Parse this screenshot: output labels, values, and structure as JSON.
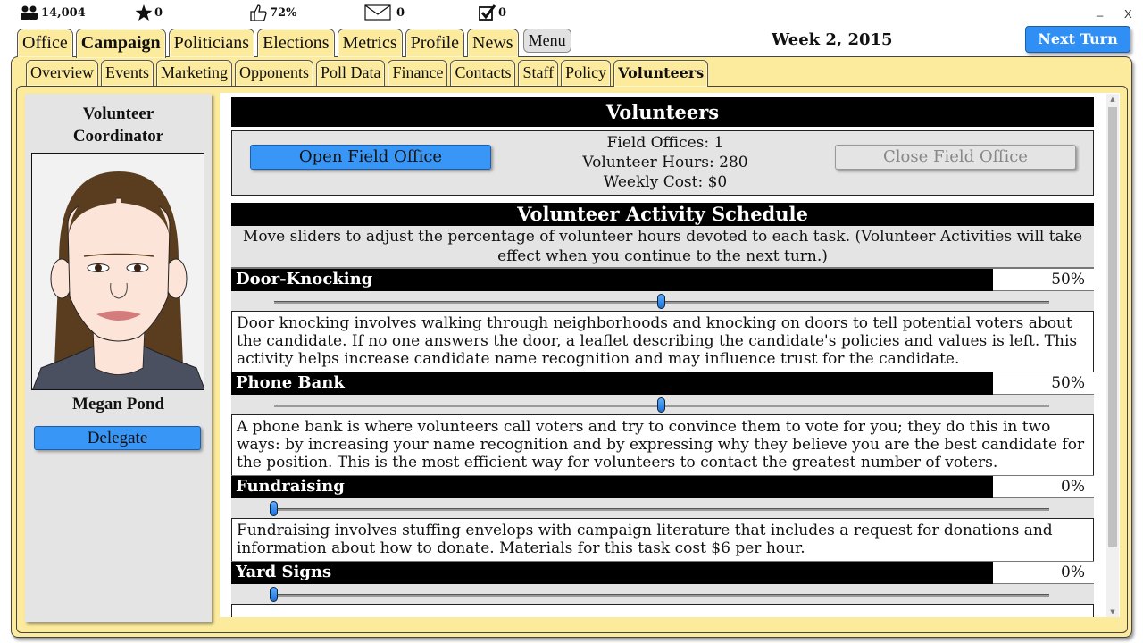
{
  "stats": {
    "followers": "14,004",
    "stars": "0",
    "approval": "72%",
    "messages": "0",
    "tasks": "0"
  },
  "window": {
    "minimize": "_",
    "close": "X"
  },
  "main_tabs": [
    {
      "label": "Office"
    },
    {
      "label": "Campaign",
      "active": true
    },
    {
      "label": "Politicians"
    },
    {
      "label": "Elections"
    },
    {
      "label": "Metrics"
    },
    {
      "label": "Profile"
    },
    {
      "label": "News"
    }
  ],
  "menu_label": "Menu",
  "week": "Week 2, 2015",
  "next_turn_label": "Next Turn",
  "sub_tabs": [
    {
      "label": "Overview"
    },
    {
      "label": "Events"
    },
    {
      "label": "Marketing"
    },
    {
      "label": "Opponents"
    },
    {
      "label": "Poll Data"
    },
    {
      "label": "Finance"
    },
    {
      "label": "Contacts"
    },
    {
      "label": "Staff"
    },
    {
      "label": "Policy"
    },
    {
      "label": "Volunteers",
      "active": true
    }
  ],
  "coordinator": {
    "title_line1": "Volunteer",
    "title_line2": "Coordinator",
    "name": "Megan Pond",
    "delegate_label": "Delegate"
  },
  "volunteers": {
    "title": "Volunteers",
    "open_label": "Open Field Office",
    "close_label": "Close Field Office",
    "field_offices": "Field Offices: 1",
    "volunteer_hours": "Volunteer Hours: 280",
    "weekly_cost": "Weekly Cost: $0"
  },
  "schedule": {
    "title": "Volunteer Activity Schedule",
    "description": "Move sliders to adjust the percentage of volunteer hours devoted to each task. (Volunteer Activities will take effect when you continue to the next turn.)",
    "activities": [
      {
        "name": "Door-Knocking",
        "percent_label": "50%",
        "value": 50,
        "description": "Door knocking involves walking through neighborhoods and knocking on doors to tell potential voters about the candidate. If no one answers the door, a leaflet describing the candidate's policies and values is left. This activity helps increase candidate name recognition and may influence trust for the candidate."
      },
      {
        "name": "Phone Bank",
        "percent_label": "50%",
        "value": 50,
        "description": "A phone bank is where volunteers call voters and try to convince them to vote for you; they do this in two ways: by increasing your name recognition and by expressing why they believe you are the best candidate for the position. This is the most efficient way for volunteers to contact the greatest number of voters."
      },
      {
        "name": "Fundraising",
        "percent_label": "0%",
        "value": 0,
        "description": "Fundraising involves stuffing envelops with campaign literature that includes a request for donations and information about how to donate. Materials for this task cost $6 per hour."
      },
      {
        "name": "Yard Signs",
        "percent_label": "0%",
        "value": 0,
        "description": ""
      }
    ]
  },
  "colors": {
    "panel": "#fdeb9d",
    "accent_button": "#3896f7",
    "next_turn": "#2f8ff5"
  }
}
